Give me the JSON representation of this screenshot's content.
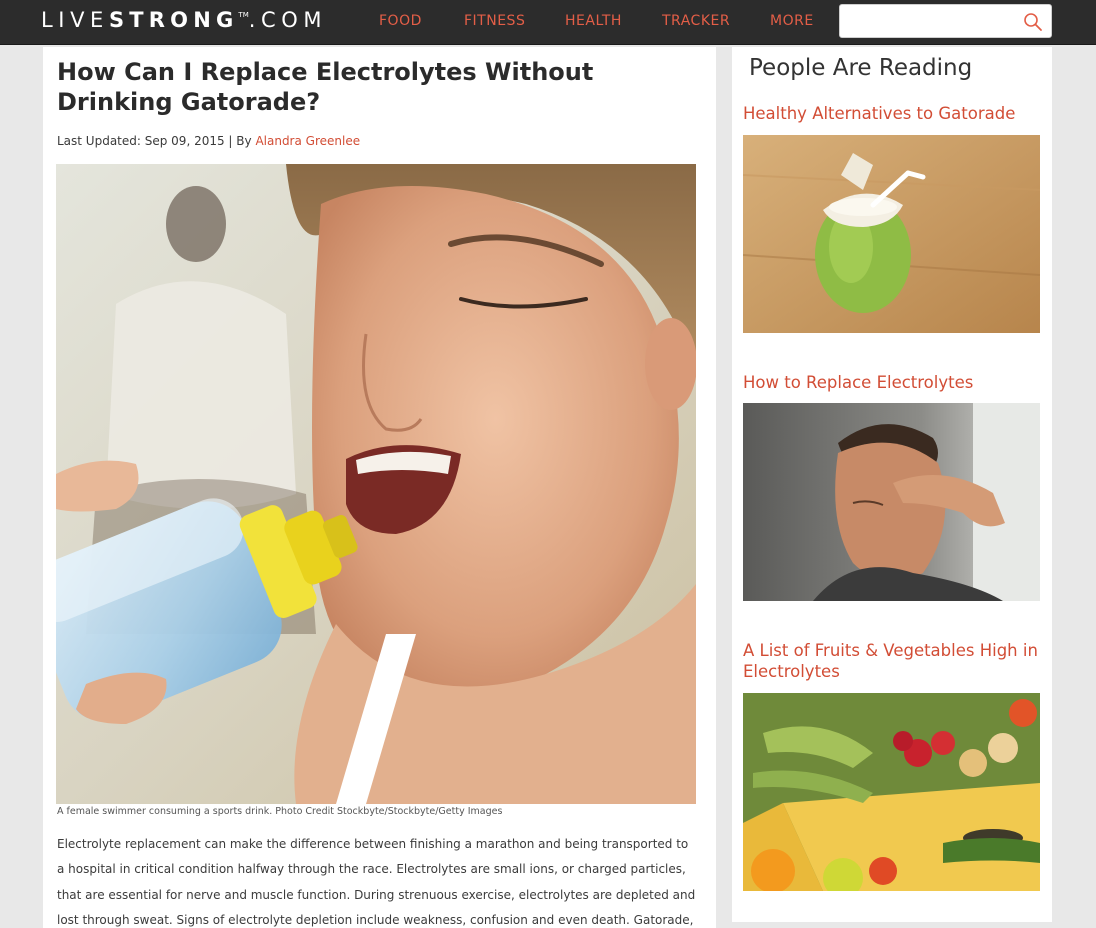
{
  "site": {
    "logo_light": "LIVE",
    "logo_bold": "STRONG",
    "logo_tm": "TM",
    "logo_suffix": ".COM"
  },
  "nav": {
    "items": [
      {
        "label": "FOOD"
      },
      {
        "label": "FITNESS"
      },
      {
        "label": "HEALTH"
      },
      {
        "label": "TRACKER"
      },
      {
        "label": "MORE"
      }
    ],
    "search": {
      "value": "",
      "placeholder": ""
    }
  },
  "article": {
    "title": "How Can I Replace Electrolytes Without Drinking Gatorade?",
    "byline_prefix": "Last Updated: Sep 09, 2015 | By ",
    "author": "Alandra Greenlee",
    "caption": "A female swimmer consuming a sports drink. Photo Credit Stockbyte/Stockbyte/Getty Images",
    "body": "Electrolyte replacement can make the difference between finishing a marathon and being transported to a hospital in critical condition halfway through the race. Electrolytes are small ions, or charged particles, that are essential for nerve and muscle function. During strenuous exercise, electrolytes are depleted and lost through sweat. Signs of electrolyte depletion include weakness, confusion and even death. Gatorade, a"
  },
  "sidebar": {
    "heading": "People Are Reading",
    "items": [
      {
        "title": "Healthy Alternatives to Gatorade"
      },
      {
        "title": "How to Replace Electrolytes"
      },
      {
        "title": "A List of Fruits & Vegetables High in Electrolytes"
      }
    ]
  },
  "colors": {
    "accent": "#d24d35",
    "nav_bg": "#2c2c2c"
  }
}
